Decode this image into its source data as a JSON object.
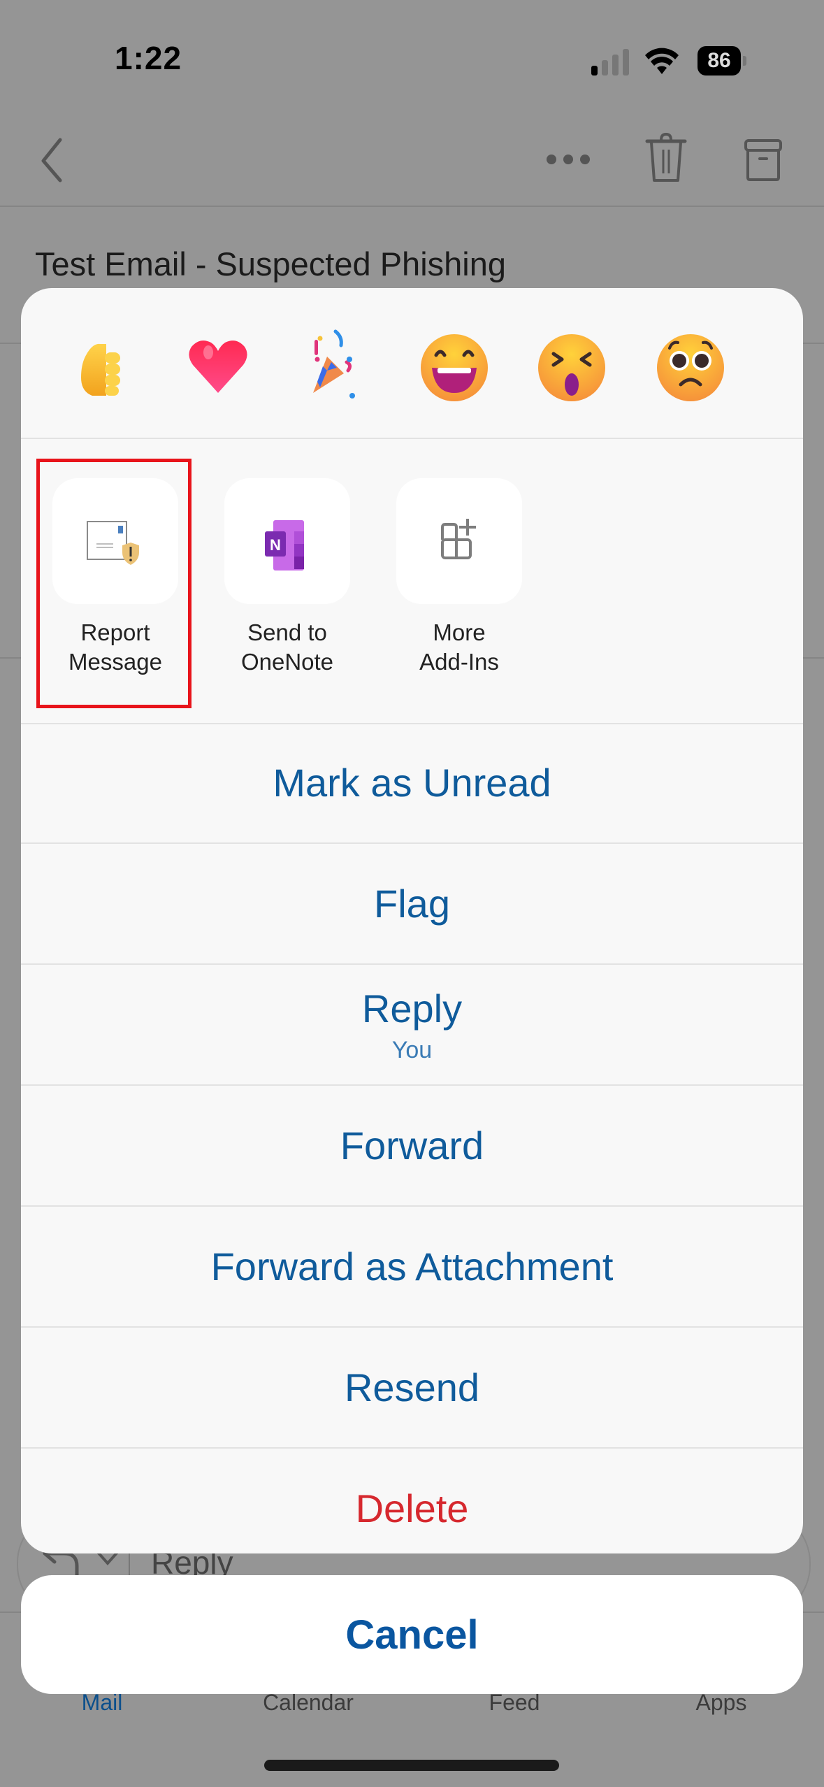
{
  "status_bar": {
    "time": "1:22",
    "battery_percent": "86",
    "signal_bars_active": 1,
    "signal_bars_total": 4
  },
  "nav_bar": {
    "icons": [
      "back-icon",
      "more-icon",
      "trash-icon",
      "archive-icon"
    ]
  },
  "email": {
    "subject": "Test Email - Suspected Phishing"
  },
  "reply_bar": {
    "label": "Reply"
  },
  "tab_bar": {
    "tabs": [
      {
        "label": "Mail",
        "active": true
      },
      {
        "label": "Calendar",
        "active": false
      },
      {
        "label": "Feed",
        "active": false
      },
      {
        "label": "Apps",
        "active": false
      }
    ]
  },
  "action_sheet": {
    "reactions": [
      "thumbs-up",
      "heart",
      "party-popper",
      "grinning-face",
      "tired-face",
      "worried-face"
    ],
    "addins": [
      {
        "line1": "Report",
        "line2": "Message",
        "icon": "report-message-icon",
        "highlighted": true
      },
      {
        "line1": "Send to",
        "line2": "OneNote",
        "icon": "onenote-icon",
        "highlighted": false
      },
      {
        "line1": "More",
        "line2": "Add-Ins",
        "icon": "add-ins-icon",
        "highlighted": false
      }
    ],
    "actions": [
      {
        "label": "Mark as Unread"
      },
      {
        "label": "Flag"
      },
      {
        "label": "Reply",
        "sublabel": "You"
      },
      {
        "label": "Forward"
      },
      {
        "label": "Forward as Attachment"
      },
      {
        "label": "Resend"
      },
      {
        "label": "Delete",
        "destructive": true
      }
    ],
    "cancel_label": "Cancel"
  },
  "colors": {
    "action_blue": "#0f5b9b",
    "destructive_red": "#d6282e",
    "highlight_red": "#e8141b",
    "overlay_gray": "#959595"
  }
}
